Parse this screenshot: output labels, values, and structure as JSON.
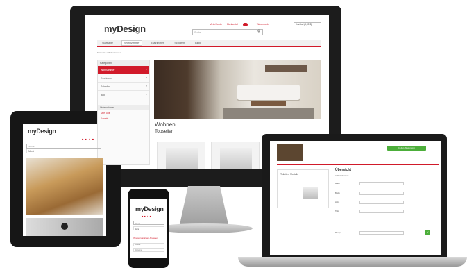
{
  "brand": {
    "logo_text": "myDesign",
    "accent": "#d11a2a",
    "green": "#4cae3a"
  },
  "monitor": {
    "top_links": [
      "Mein Konto",
      "Merkzettel",
      "Warenkorb"
    ],
    "merkzettel_count": "0",
    "cart": "0 Artikel (0,00 €)",
    "search_placeholder": "Suche",
    "nav": [
      "Startseite",
      "Wohnzimmer",
      "Esszimmer",
      "Schlafen",
      "Blog"
    ],
    "breadcrumb": "Startseite > Wohnzimmer",
    "sidebar_head": "Kategorien",
    "sidebar_items": [
      "Wohnzimmer",
      "Esszimmer",
      "Schlafen",
      "Blog"
    ],
    "sidebar_head2": "Unternehmen",
    "sidebar_links": [
      "Über uns",
      "Kontakt"
    ],
    "page_title": "Wohnen",
    "section_title": "Topseller"
  },
  "tablet": {
    "search_placeholder": "Suche",
    "menu": "Menü"
  },
  "phone": {
    "search_placeholder": "Suche",
    "menu": "Menü",
    "text": "Ihre persönlichen Angaben",
    "fields": [
      "Anrede",
      "Vorname"
    ]
  },
  "laptop": {
    "green_button": "In den Warenkorb",
    "left_title": "Toiletten Modelle",
    "title": "Übersicht",
    "info": "Artikel Nummer",
    "labels": [
      "Maße",
      "Breite",
      "Höhe",
      "Tiefe",
      "Menge"
    ]
  }
}
